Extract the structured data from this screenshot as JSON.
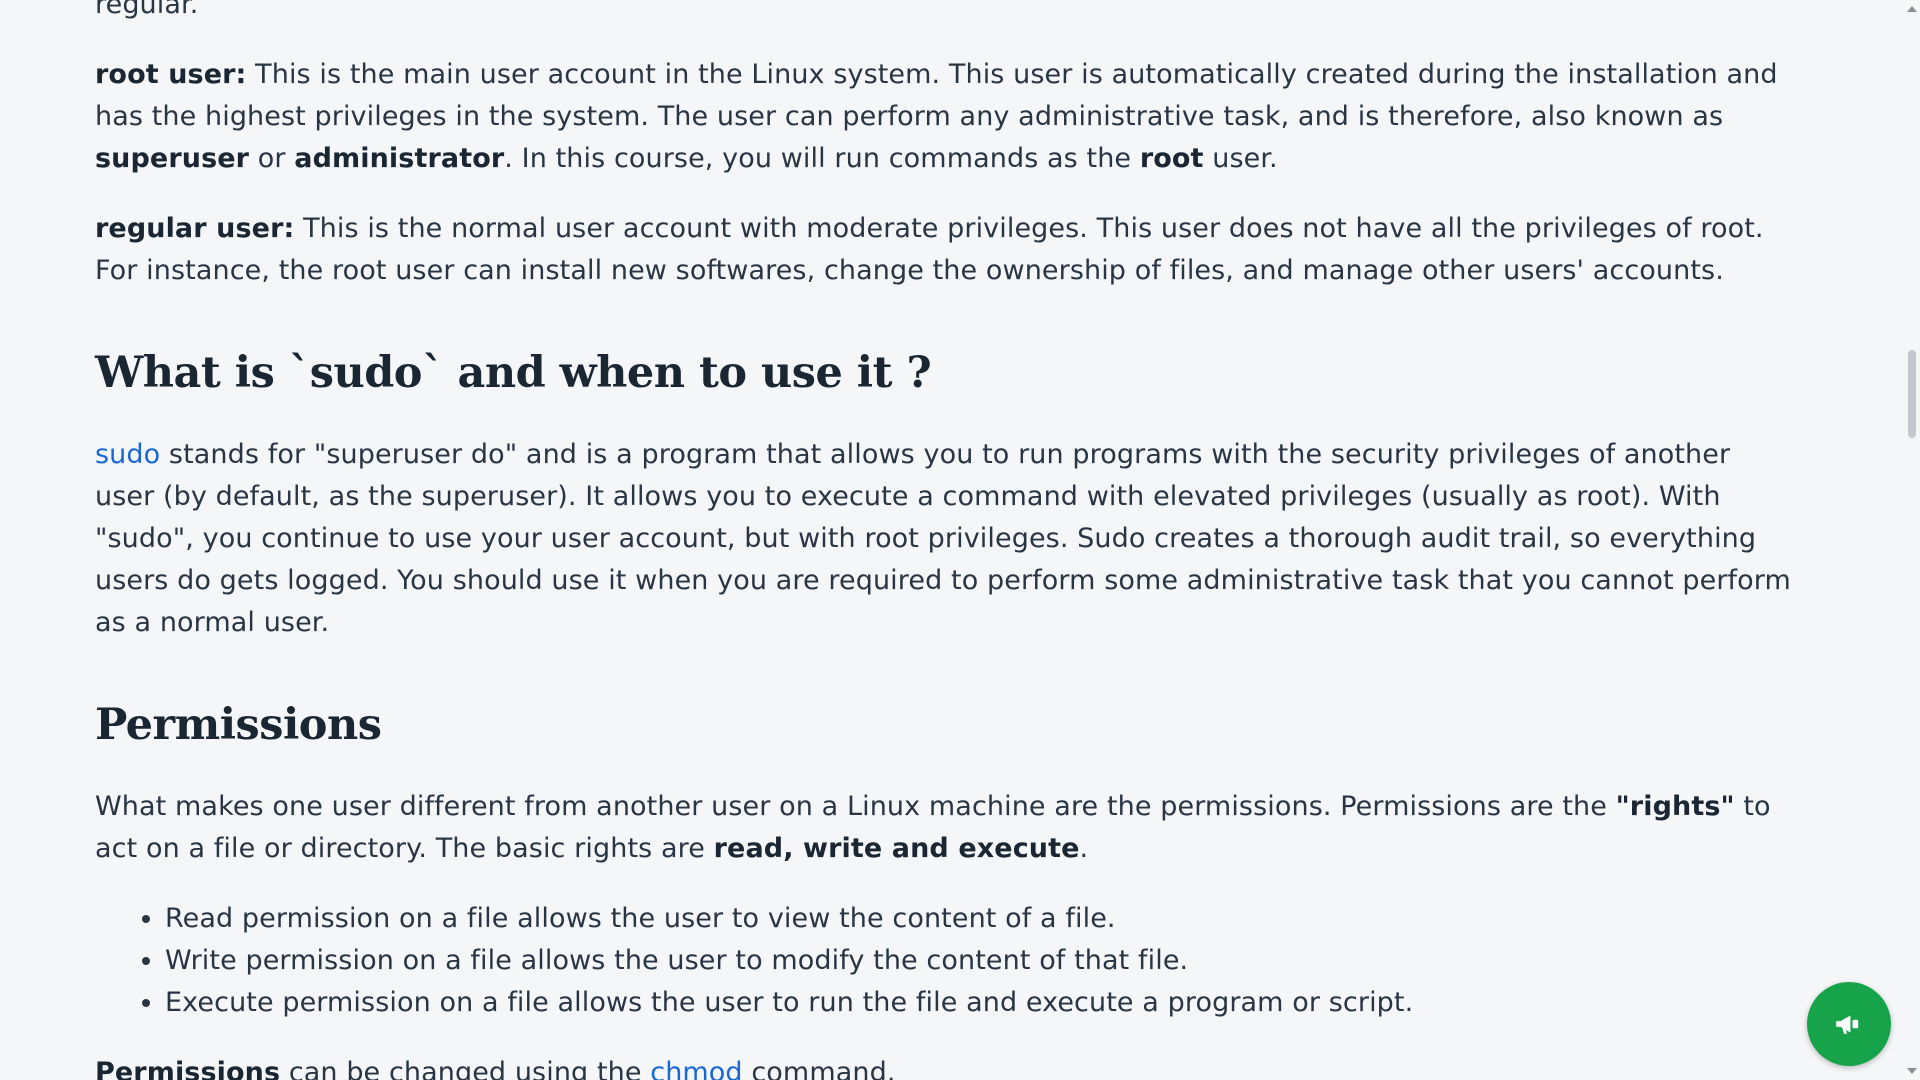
{
  "article": {
    "top_fragment": "regular.",
    "root_user": {
      "term": "root user:",
      "text1": " This is the main user account in the Linux system. This user is automatically created during the installation and has the highest privileges in the system. The user can perform any administrative task, and is therefore, also known as ",
      "bold1": "superuser",
      "text2": " or ",
      "bold2": "administrator",
      "text3": ". In this course, you will run commands as the ",
      "bold3": "root",
      "text4": " user."
    },
    "regular_user": {
      "term": "regular user:",
      "text": " This is the normal user account with moderate privileges. This user does not have all the privileges of root. For instance, the root user can install new softwares, change the ownership of files, and manage other users' accounts."
    },
    "sudo_heading": "What is `sudo` and when to use it ?",
    "sudo_para": {
      "link": "sudo",
      "text": " stands for \"superuser do\" and is a program that allows you to run programs with the security privileges of another user (by default, as the superuser). It allows you to execute a command with elevated privileges (usually as root). With \"sudo\", you continue to use your user account, but with root privileges. Sudo creates a thorough audit trail, so everything users do gets logged. You should use it when you are required to perform some administrative task that you cannot perform as a normal user."
    },
    "permissions_heading": "Permissions",
    "permissions_para": {
      "text1": "What makes one user different from another user on a Linux machine are the permissions. Permissions are the ",
      "bold1": "\"rights\"",
      "text2": " to act on a file or directory. The basic rights are ",
      "bold2": "read, write and execute",
      "text3": "."
    },
    "permission_items": [
      "Read permission on a file allows the user to view the content of a file.",
      "Write permission on a file allows the user to modify the content of that file.",
      "Execute permission on a file allows the user to run the file and execute a program or script."
    ],
    "chmod_para": {
      "bold": "Permissions",
      "text1": " can be changed using the ",
      "link": "chmod",
      "text2": " command."
    }
  },
  "fab": {
    "icon": "megaphone-icon",
    "color": "#16a34a"
  },
  "colors": {
    "background": "#f4f6f8",
    "text": "#2a3544",
    "link": "#1968d6"
  }
}
